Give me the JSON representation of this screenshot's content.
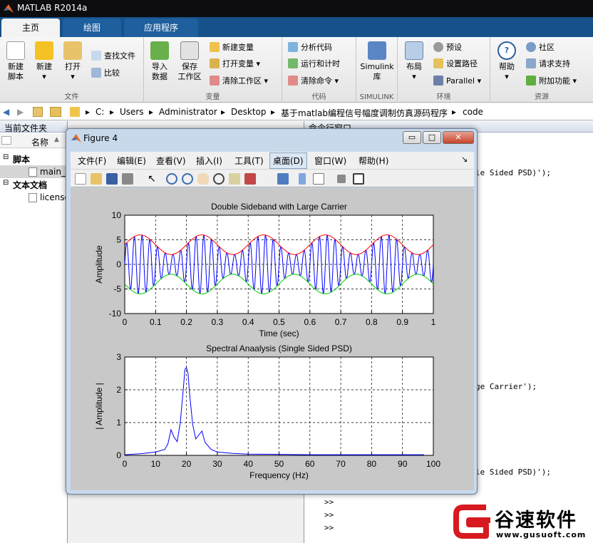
{
  "app": {
    "title": "MATLAB R2014a"
  },
  "tabs": [
    "主页",
    "绘图",
    "应用程序"
  ],
  "ribbon": {
    "file": {
      "new_script": [
        "新建",
        "脚本"
      ],
      "new": "新建",
      "open": "打开",
      "find_files": "查找文件",
      "compare": "比较",
      "group": "文件"
    },
    "variable": {
      "import": [
        "导入",
        "数据"
      ],
      "save": [
        "保存",
        "工作区"
      ],
      "new_var": "新建变量",
      "open_var": "打开变量",
      "clear_ws": "清除工作区",
      "group": "变量"
    },
    "code": {
      "analyze": "分析代码",
      "run_time": "运行和计时",
      "clear_cmd": "清除命令",
      "group": "代码"
    },
    "simulink": {
      "btn": [
        "Simulink",
        "库"
      ],
      "group": "SIMULINK"
    },
    "env": {
      "layout": "布局",
      "prefs": "预设",
      "set_path": "设置路径",
      "parallel": "Parallel",
      "group": "环境"
    },
    "res": {
      "help": "帮助",
      "community": "社区",
      "support": "请求支持",
      "addons": "附加功能",
      "group": "资源"
    }
  },
  "address": {
    "segments": [
      "C:",
      "Users",
      "Administrator",
      "Desktop",
      "基于matlab编程信号幅度调制仿真源码程序",
      "code"
    ]
  },
  "left_pane": {
    "title": "当前文件夹",
    "col_name": "名称",
    "sort_arrow": "▲",
    "scripts": "脚本",
    "script_file": "main_",
    "text_docs": "文本文档",
    "text_file": "license"
  },
  "right_pane": {
    "title": "命令行窗口",
    "lines": [
      "le Sided PSD)');",
      "ge Carrier');",
      "le Sided PSD)');",
      ">>",
      ">>",
      ">>"
    ]
  },
  "figure": {
    "title": "Figure 4",
    "menu": [
      "文件(F)",
      "编辑(E)",
      "查看(V)",
      "插入(I)",
      "工具(T)",
      "桌面(D)",
      "窗口(W)",
      "帮助(H)"
    ],
    "dock_arrow": "↘",
    "buttons": {
      "min": "▭",
      "max": "□",
      "close": "✕"
    }
  },
  "chart_data": [
    {
      "type": "line",
      "title": "Double Sideband with Large Carrier",
      "xlabel": "Time (sec)",
      "ylabel": "Amplitude",
      "xlim": [
        0,
        1
      ],
      "ylim": [
        -10,
        10
      ],
      "xticks": [
        0,
        0.1,
        0.2,
        0.3,
        0.4,
        0.5,
        0.6,
        0.7,
        0.8,
        0.9,
        1
      ],
      "xtick_labels": [
        "0",
        "0.1",
        "0.2",
        "0.3",
        "0.4",
        "0.5",
        "0.6",
        "0.7",
        "0.8",
        "0.9",
        "1"
      ],
      "yticks": [
        -10,
        -5,
        0,
        5,
        10
      ],
      "ytick_labels": [
        "-10",
        "-5",
        "0",
        "5",
        "10"
      ],
      "grid": true,
      "series": [
        {
          "color": "#0000ff",
          "function": "(4 + 2*sin(2*pi*5*t))*sin(2*pi*40*t)"
        },
        {
          "color": "#ff0000",
          "function": "4 + 2*sin(2*pi*5*t)"
        },
        {
          "color": "#00cc00",
          "function": "-(4 + 2*sin(2*pi*5*t))"
        }
      ]
    },
    {
      "type": "line",
      "title": "Spectral Anaalysis (Single Sided PSD)",
      "xlabel": "Frequency (Hz)",
      "ylabel": "| Amplitude |",
      "xlim": [
        0,
        100
      ],
      "ylim": [
        0,
        3
      ],
      "xticks": [
        0,
        10,
        20,
        30,
        40,
        50,
        60,
        70,
        80,
        90,
        100
      ],
      "xtick_labels": [
        "0",
        "10",
        "20",
        "30",
        "40",
        "50",
        "60",
        "70",
        "80",
        "90",
        "100"
      ],
      "yticks": [
        0,
        1,
        2,
        3
      ],
      "ytick_labels": [
        "0",
        "1",
        "2",
        "3"
      ],
      "grid": true,
      "series": [
        {
          "color": "#0000ff",
          "x": [
            0,
            5,
            10,
            13,
            14,
            15,
            16,
            17,
            18,
            19,
            19.5,
            20,
            20.5,
            21,
            22,
            23,
            24,
            25,
            26,
            28,
            30,
            35,
            40,
            50,
            60,
            70,
            80,
            90,
            97
          ],
          "y": [
            0.02,
            0.05,
            0.1,
            0.18,
            0.35,
            0.78,
            0.55,
            0.42,
            1.0,
            2.05,
            2.62,
            2.68,
            2.5,
            1.9,
            0.95,
            0.5,
            0.62,
            0.74,
            0.4,
            0.18,
            0.1,
            0.06,
            0.04,
            0.03,
            0.02,
            0.02,
            0.02,
            0.02,
            0.02
          ]
        }
      ]
    }
  ],
  "watermark": {
    "name": "谷速软件",
    "url": "www.gusuoft.com"
  },
  "colors": {
    "tab_blue": "#17518a",
    "title_dark": "#0d0d10",
    "fig_frame": "#c9d9ec"
  }
}
